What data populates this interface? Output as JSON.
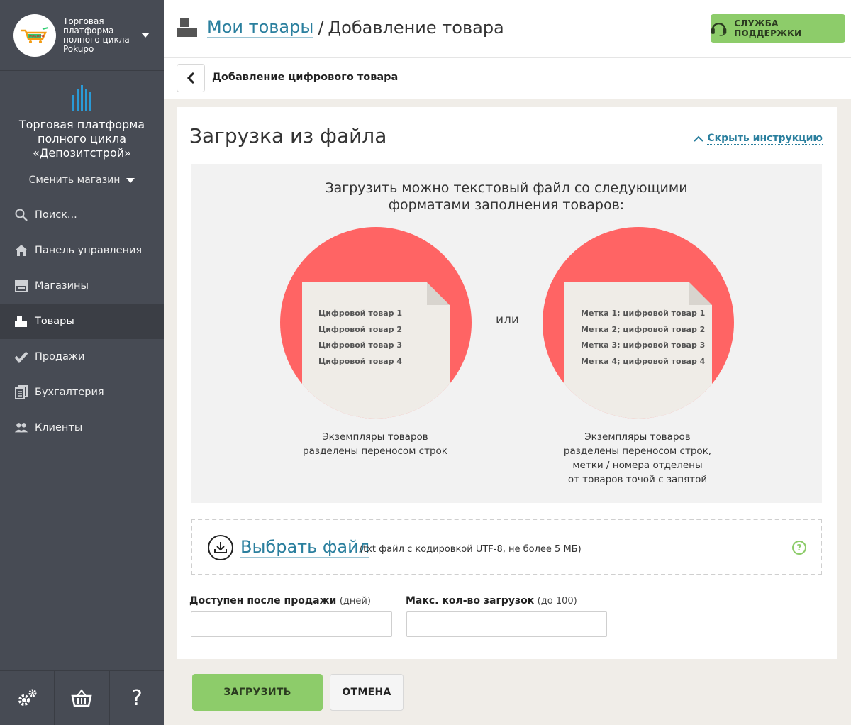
{
  "sidebar": {
    "store_name": "Торговая платформа полного цикла Pokupo",
    "logo_text": "POKUPO",
    "brand_title": "Торговая платформа полного цикла «Депозитстрой»",
    "change_store": "Сменить магазин",
    "nav": [
      {
        "label": "Поиск...",
        "icon": "search-icon"
      },
      {
        "label": "Панель управления",
        "icon": "home-icon"
      },
      {
        "label": "Магазины",
        "icon": "store-icon"
      },
      {
        "label": "Товары",
        "icon": "boxes-icon",
        "active": true
      },
      {
        "label": "Продажи",
        "icon": "check-icon"
      },
      {
        "label": "Бухгалтерия",
        "icon": "documents-icon"
      },
      {
        "label": "Клиенты",
        "icon": "users-icon"
      }
    ],
    "footer": {
      "help": "?"
    }
  },
  "header": {
    "breadcrumb_link": "Мои товары",
    "breadcrumb_sep": "/",
    "breadcrumb_current": "Добавление товара",
    "support_label": "СЛУЖБА ПОДДЕРЖКИ"
  },
  "subheader": {
    "title": "Добавление цифрового товара"
  },
  "card": {
    "title": "Загрузка из файла",
    "hide_instructions": "Скрыть инструкцию",
    "info_heading_line1": "Загрузить можно текстовый файл со следующими",
    "info_heading_line2": "форматами заполнения товаров:",
    "or_label": "или",
    "example1": {
      "lines": [
        "Цифровой товар 1",
        "Цифровой товар 2",
        "Цифровой товар 3",
        "Цифровой товар 4"
      ],
      "caption": [
        "Экземпляры товаров",
        "разделены переносом строк"
      ]
    },
    "example2": {
      "lines": [
        "Метка 1; цифровой товар 1",
        "Метка 2; цифровой товар 2",
        "Метка 3; цифровой товар 3",
        "Метка 4; цифровой товар 4"
      ],
      "caption": [
        "Экземпляры товаров",
        "разделены переносом строк,",
        "метки / номера отделены",
        "от товаров точой с запятой"
      ]
    },
    "choose_file": "Выбрать файл",
    "choose_hint": "(txt файл с кодировкой UTF-8, не более 5 МБ)",
    "help": "?",
    "field1_label": "Доступен после продажи",
    "field1_note": "(дней)",
    "field1_value": "",
    "field2_label": "Макс. кол-во загрузок",
    "field2_note": "(до 100)",
    "field2_value": ""
  },
  "actions": {
    "upload": "ЗАГРУЗИТЬ",
    "cancel": "ОТМЕНА"
  },
  "colors": {
    "sidebar": "#474b54",
    "accent_green": "#8dcc6a",
    "link": "#2a7f9e",
    "circle_red": "#ff6464"
  }
}
